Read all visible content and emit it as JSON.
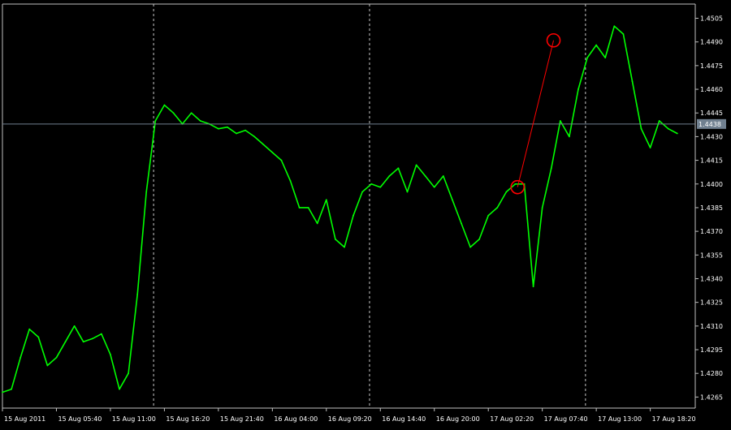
{
  "chart_data": {
    "type": "line",
    "title": "",
    "xlabel": "",
    "ylabel": "",
    "x_ticks": [
      "15 Aug 2011",
      "15 Aug 05:40",
      "15 Aug 11:00",
      "15 Aug 16:20",
      "15 Aug 21:40",
      "16 Aug 04:00",
      "16 Aug 09:20",
      "16 Aug 14:40",
      "16 Aug 20:00",
      "17 Aug 02:20",
      "17 Aug 07:40",
      "17 Aug 13:00",
      "17 Aug 18:20"
    ],
    "y_ticks": [
      1.4265,
      1.428,
      1.4295,
      1.431,
      1.4325,
      1.434,
      1.4355,
      1.437,
      1.4385,
      1.44,
      1.4415,
      1.443,
      1.4445,
      1.446,
      1.4475,
      1.449,
      1.4505
    ],
    "y_tick_labels": [
      "1.4265",
      "1.4280",
      "1.4295",
      "1.4310",
      "1.4325",
      "1.4340",
      "1.4355",
      "1.4370",
      "1.4385",
      "1.4400",
      "1.4415",
      "1.4430",
      "1.4445",
      "1.4460",
      "1.4475",
      "1.4490",
      "1.4505"
    ],
    "ylim": [
      1.4258,
      1.4514
    ],
    "x_range": [
      0,
      154
    ],
    "grid": "vertical-dashed",
    "current_price": 1.4438,
    "current_price_label": "1.4438",
    "series": [
      {
        "color": "#00ff00",
        "x": [
          0,
          2,
          4,
          6,
          8,
          10,
          12,
          14,
          16,
          18,
          20,
          22,
          24,
          26,
          28,
          30,
          32,
          34,
          36,
          38,
          40,
          42,
          44,
          46,
          48,
          50,
          52,
          54,
          56,
          58,
          60,
          62,
          64,
          66,
          68,
          70,
          72,
          74,
          76,
          78,
          80,
          82,
          84,
          86,
          88,
          90,
          92,
          94,
          96,
          98,
          100,
          102,
          104,
          106,
          108,
          110,
          112,
          114,
          116,
          118,
          120,
          122,
          124,
          126,
          128,
          130,
          132,
          134,
          136,
          138,
          140,
          142,
          144,
          146,
          148,
          150
        ],
        "y": [
          1.4268,
          1.427,
          1.429,
          1.4308,
          1.4303,
          1.4285,
          1.429,
          1.43,
          1.431,
          1.43,
          1.4302,
          1.4305,
          1.4292,
          1.427,
          1.428,
          1.433,
          1.4395,
          1.444,
          1.445,
          1.4445,
          1.4438,
          1.4445,
          1.444,
          1.4438,
          1.4435,
          1.4436,
          1.4432,
          1.4434,
          1.443,
          1.4425,
          1.442,
          1.4415,
          1.4402,
          1.4385,
          1.4385,
          1.4375,
          1.439,
          1.4365,
          1.436,
          1.438,
          1.4395,
          1.44,
          1.4398,
          1.4405,
          1.441,
          1.4395,
          1.4412,
          1.4405,
          1.4398,
          1.4405,
          1.439,
          1.4375,
          1.436,
          1.4365,
          1.438,
          1.4385,
          1.4395,
          1.44,
          1.44,
          1.4335,
          1.4385,
          1.441,
          1.444,
          1.443,
          1.446,
          1.448,
          1.4488,
          1.448,
          1.45,
          1.4495,
          1.4465,
          1.4435,
          1.4423,
          1.444,
          1.4435,
          1.4432
        ]
      }
    ],
    "annotations": [
      {
        "type": "circle",
        "x": 114.5,
        "y": 1.4398,
        "color": "#ff0000"
      },
      {
        "type": "circle",
        "x": 122.5,
        "y": 1.4491,
        "color": "#ff0000"
      },
      {
        "type": "line",
        "x1": 114.5,
        "y1": 1.4398,
        "x2": 122.5,
        "y2": 1.4491,
        "color": "#ff0000"
      }
    ]
  },
  "colors": {
    "background": "#000000",
    "frame": "#c0c0c0",
    "grid": "#c8c8c8",
    "price_line": "#708090",
    "price_box_bg": "#708090",
    "price_box_text": "#000000",
    "label": "#ffffff"
  }
}
